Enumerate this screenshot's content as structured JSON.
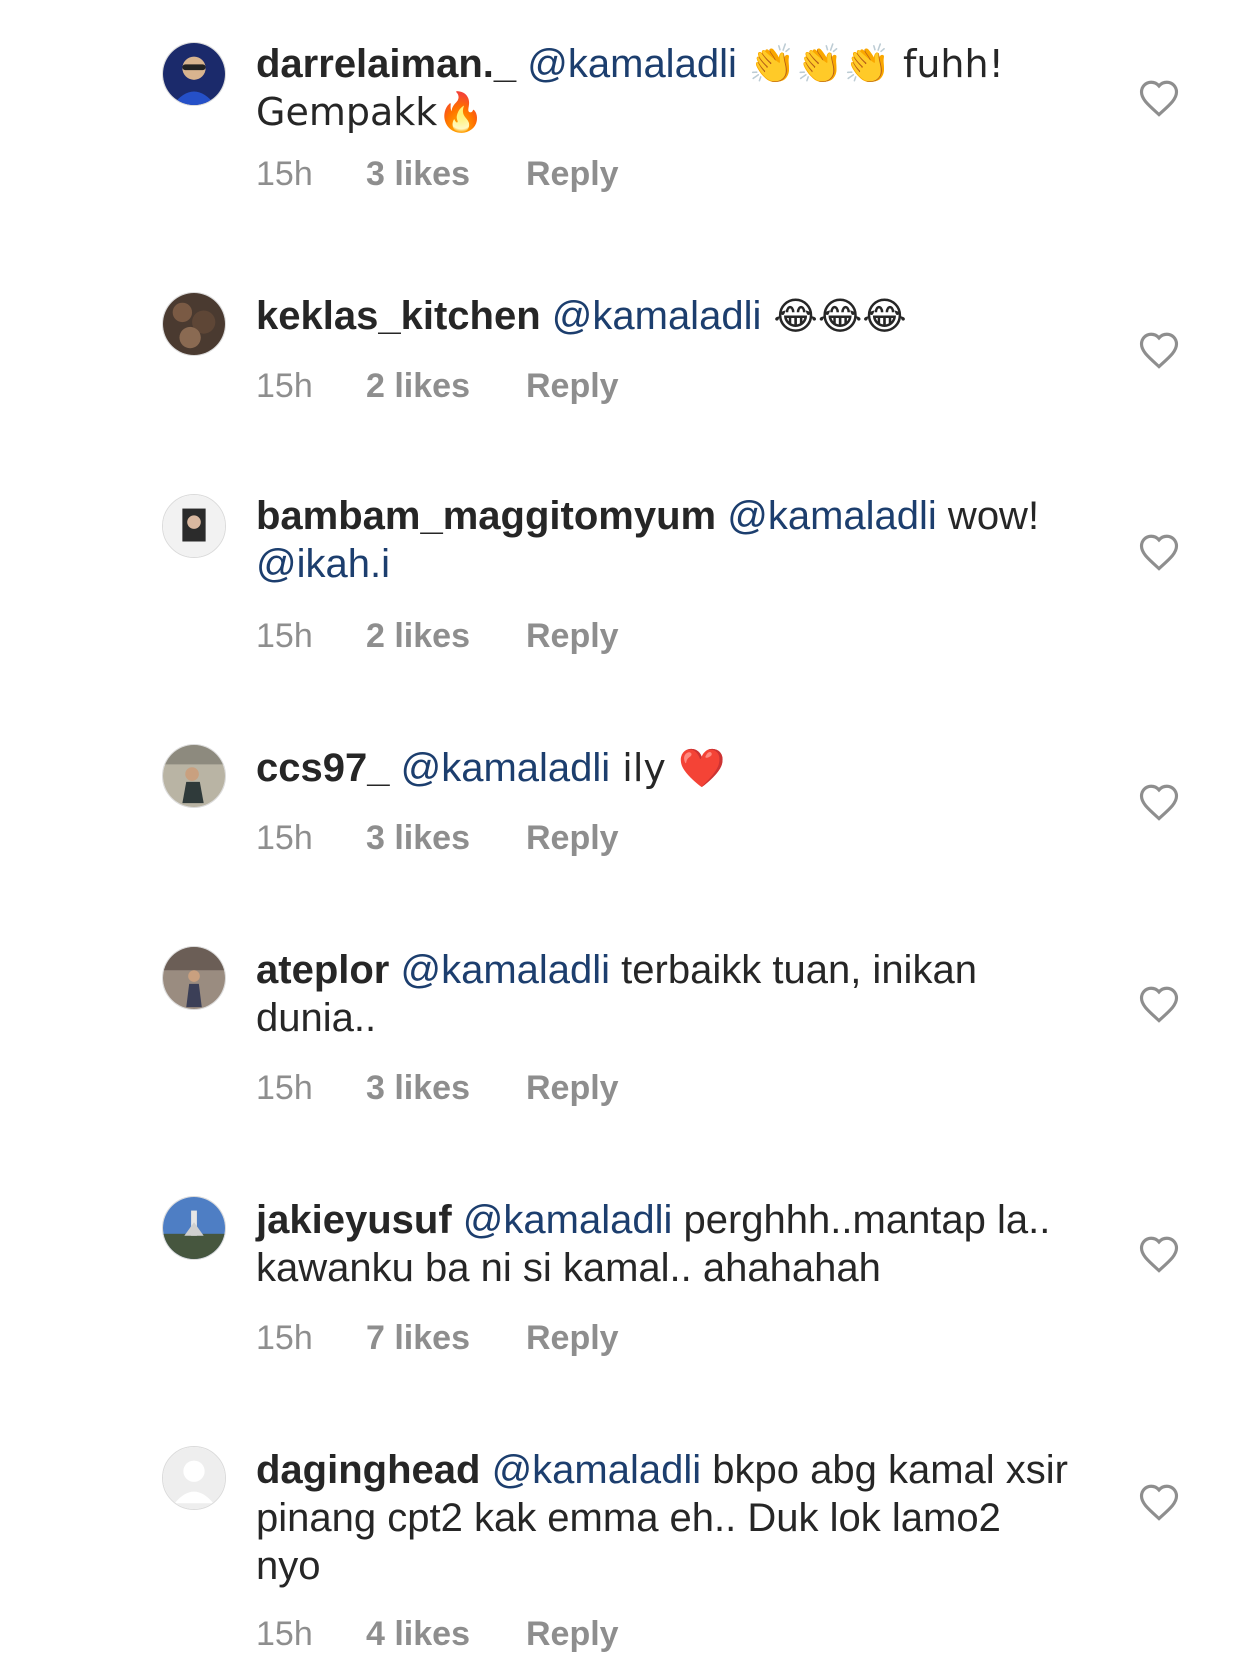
{
  "comments": [
    {
      "username": "darrelaiman._",
      "mention": "@kamaladli",
      "text": " 👏👏👏 fuhh! Gempakk🔥",
      "time": "15h",
      "likes": "3 likes",
      "reply": "Reply",
      "avatar": "profile-photo"
    },
    {
      "username": "keklas_kitchen",
      "mention": "@kamaladli",
      "text": " 😂😂😂",
      "time": "15h",
      "likes": "2 likes",
      "reply": "Reply",
      "avatar": "profile-photo"
    },
    {
      "username": "bambam_maggitomyum",
      "mention": "@kamaladli",
      "text": " wow! ",
      "mention2": "@ikah.i",
      "time": "15h",
      "likes": "2 likes",
      "reply": "Reply",
      "avatar": "profile-photo"
    },
    {
      "username": "ccs97_",
      "mention": "@kamaladli",
      "text": " ily ❤️",
      "time": "15h",
      "likes": "3 likes",
      "reply": "Reply",
      "avatar": "profile-photo"
    },
    {
      "username": "ateplor",
      "mention": "@kamaladli",
      "text": " terbaikk tuan, inikan dunia..",
      "time": "15h",
      "likes": "3 likes",
      "reply": "Reply",
      "avatar": "profile-photo"
    },
    {
      "username": "jakieyusuf",
      "mention": "@kamaladli",
      "text": " perghhh..mantap la.. kawanku ba ni si kamal.. ahahahah",
      "time": "15h",
      "likes": "7 likes",
      "reply": "Reply",
      "avatar": "profile-photo"
    },
    {
      "username": "daginghead",
      "mention": "@kamaladli",
      "text": " bkpo abg kamal xsir pinang cpt2 kak emma eh.. Duk lok lamo2 nyo",
      "time": "15h",
      "likes": "4 likes",
      "reply": "Reply",
      "avatar": "default-avatar"
    }
  ],
  "colors": {
    "username": "#262626",
    "mention": "#1c3e6e",
    "meta": "#8e8e8e",
    "heart_outline": "#8e8e8e"
  },
  "icons": {
    "like": "heart-outline-icon",
    "default_avatar": "person-silhouette-icon"
  }
}
